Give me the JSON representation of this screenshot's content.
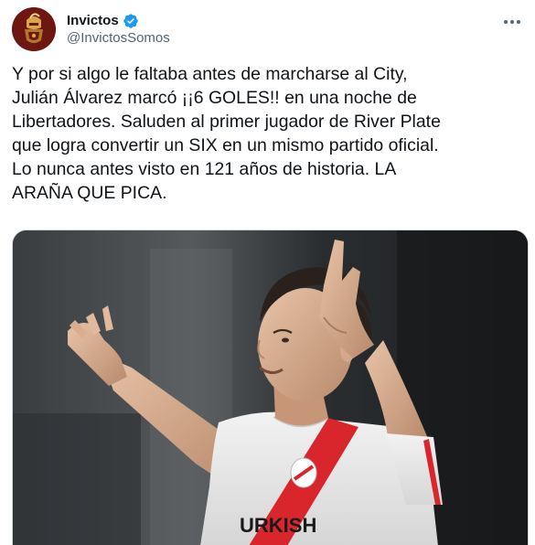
{
  "author": {
    "display_name": "Invictos",
    "handle": "@InvictosSomos",
    "verified": true,
    "avatar_icon": "invictos-crest-avatar"
  },
  "menu": {
    "icon": "more-options-icon"
  },
  "tweet": {
    "text": "Y por si algo le faltaba antes de marcharse al City,\nJulián Álvarez marcó ¡¡6 GOLES!! en una noche de\nLibertadores. Saluden al primer jugador de River Plate\nque logra convertir un SIX en un mismo partido oficial.\nLo nunca antes visto en 121 años de historia. LA\nARAÑA QUE PICA."
  },
  "media": {
    "jersey_text": "URKISH",
    "photo_subject": "footballer-celebrating-photo"
  },
  "colors": {
    "verified_blue": "#1d9bf0",
    "handle_gray": "#536471",
    "text": "#0f1419",
    "avatar_maroon": "#6e1712",
    "avatar_gold": "#d8a74a"
  }
}
